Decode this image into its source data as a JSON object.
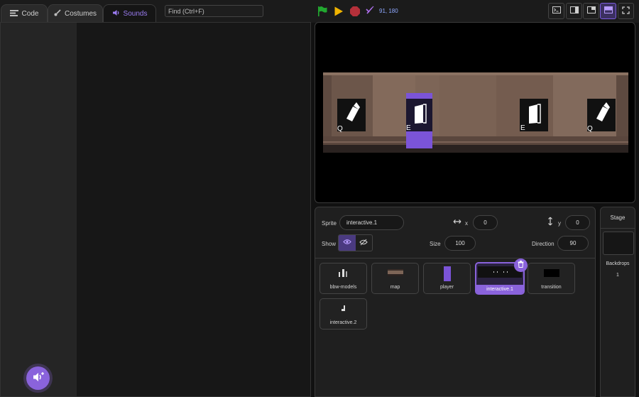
{
  "tabs": [
    {
      "label": "Code",
      "icon": "code-icon"
    },
    {
      "label": "Costumes",
      "icon": "brush-icon"
    },
    {
      "label": "Sounds",
      "icon": "speaker-icon"
    }
  ],
  "find": {
    "placeholder": "Find (Ctrl+F)"
  },
  "controls": {
    "green_flag": "green-flag-icon",
    "pause": "pause-icon",
    "stop": "stop-icon",
    "turbo": "turbo-icon",
    "coords": "91, 180"
  },
  "layout_modes": [
    "terminal-icon",
    "side-panel-icon",
    "small-stage-icon",
    "normal-stage-icon",
    "fullscreen-icon"
  ],
  "stage_scene": {
    "markers": [
      {
        "icon": "flashlight-icon",
        "key": "Q"
      },
      {
        "icon": "door-icon",
        "key": "E"
      },
      {
        "icon": "door-icon",
        "key": "E"
      },
      {
        "icon": "flashlight-icon",
        "key": "Q"
      }
    ]
  },
  "sprite_info": {
    "sprite_label": "Sprite",
    "sprite_name": "interactive.1",
    "x_label": "x",
    "x_value": "0",
    "y_label": "y",
    "y_value": "0",
    "show_label": "Show",
    "size_label": "Size",
    "size_value": "100",
    "direction_label": "Direction",
    "direction_value": "90"
  },
  "sprites": [
    {
      "name": "bbw-models",
      "selected": false
    },
    {
      "name": "map",
      "selected": false
    },
    {
      "name": "player",
      "selected": false
    },
    {
      "name": "interactive.1",
      "selected": true
    },
    {
      "name": "transition",
      "selected": false
    },
    {
      "name": "interactive.2",
      "selected": false
    }
  ],
  "stage_panel": {
    "title": "Stage",
    "backdrops_label": "Backdrops",
    "backdrops_count": "1"
  },
  "colors": {
    "accent": "#8a63dc",
    "green_flag": "#22a830",
    "pause": "#f0b400",
    "stop": "#c0392b",
    "coords": "#8fa8ff"
  }
}
